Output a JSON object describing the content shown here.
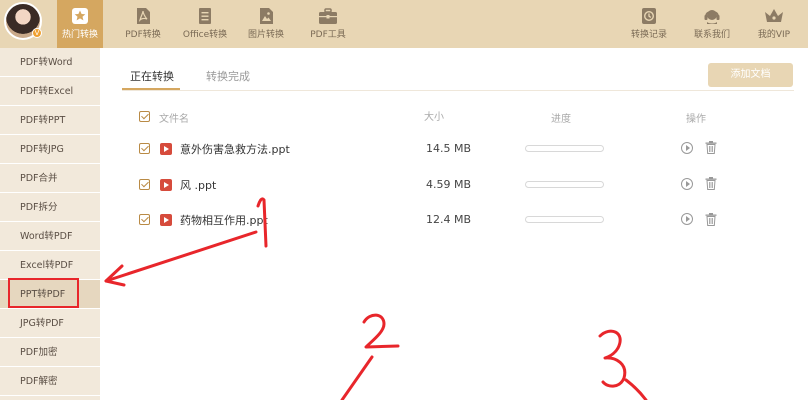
{
  "colors": {
    "topbar": "#e8d6b4",
    "accent": "#d5a760",
    "sidebar": "#f2e9db",
    "annotation": "#e8262b"
  },
  "topnav": {
    "items": [
      {
        "label": "热门转换",
        "icon": "star-icon",
        "active": true
      },
      {
        "label": "PDF转换",
        "icon": "pdf-icon"
      },
      {
        "label": "Office转换",
        "icon": "document-icon"
      },
      {
        "label": "图片转换",
        "icon": "image-icon"
      },
      {
        "label": "PDF工具",
        "icon": "toolbox-icon"
      }
    ],
    "right_items": [
      {
        "label": "转换记录",
        "icon": "clock-icon"
      },
      {
        "label": "联系我们",
        "icon": "headset-icon"
      },
      {
        "label": "我的VIP",
        "icon": "crown-icon"
      }
    ]
  },
  "sidebar": {
    "items": [
      {
        "label": "PDF转Word"
      },
      {
        "label": "PDF转Excel"
      },
      {
        "label": "PDF转PPT"
      },
      {
        "label": "PDF转JPG"
      },
      {
        "label": "PDF合并"
      },
      {
        "label": "PDF拆分"
      },
      {
        "label": "Word转PDF"
      },
      {
        "label": "Excel转PDF"
      },
      {
        "label": "PPT转PDF",
        "active": true
      },
      {
        "label": "JPG转PDF"
      },
      {
        "label": "PDF加密"
      },
      {
        "label": "PDF解密"
      }
    ]
  },
  "tabs": [
    {
      "label": "正在转换",
      "active": true
    },
    {
      "label": "转换完成"
    }
  ],
  "add_button": "添加文档",
  "table": {
    "headers": {
      "name": "文件名",
      "size": "大小",
      "progress": "进度",
      "action": "操作"
    },
    "rows": [
      {
        "name": "意外伤害急救方法.ppt",
        "size": "14.5 MB",
        "checked": true,
        "progress": 0
      },
      {
        "name": "风 .ppt",
        "size": "4.59 MB",
        "checked": true,
        "progress": 0
      },
      {
        "name": "药物相互作用.ppt",
        "size": "12.4 MB",
        "checked": true,
        "progress": 0
      }
    ]
  },
  "annotations": {
    "labels": [
      "1",
      "2",
      "3"
    ]
  }
}
